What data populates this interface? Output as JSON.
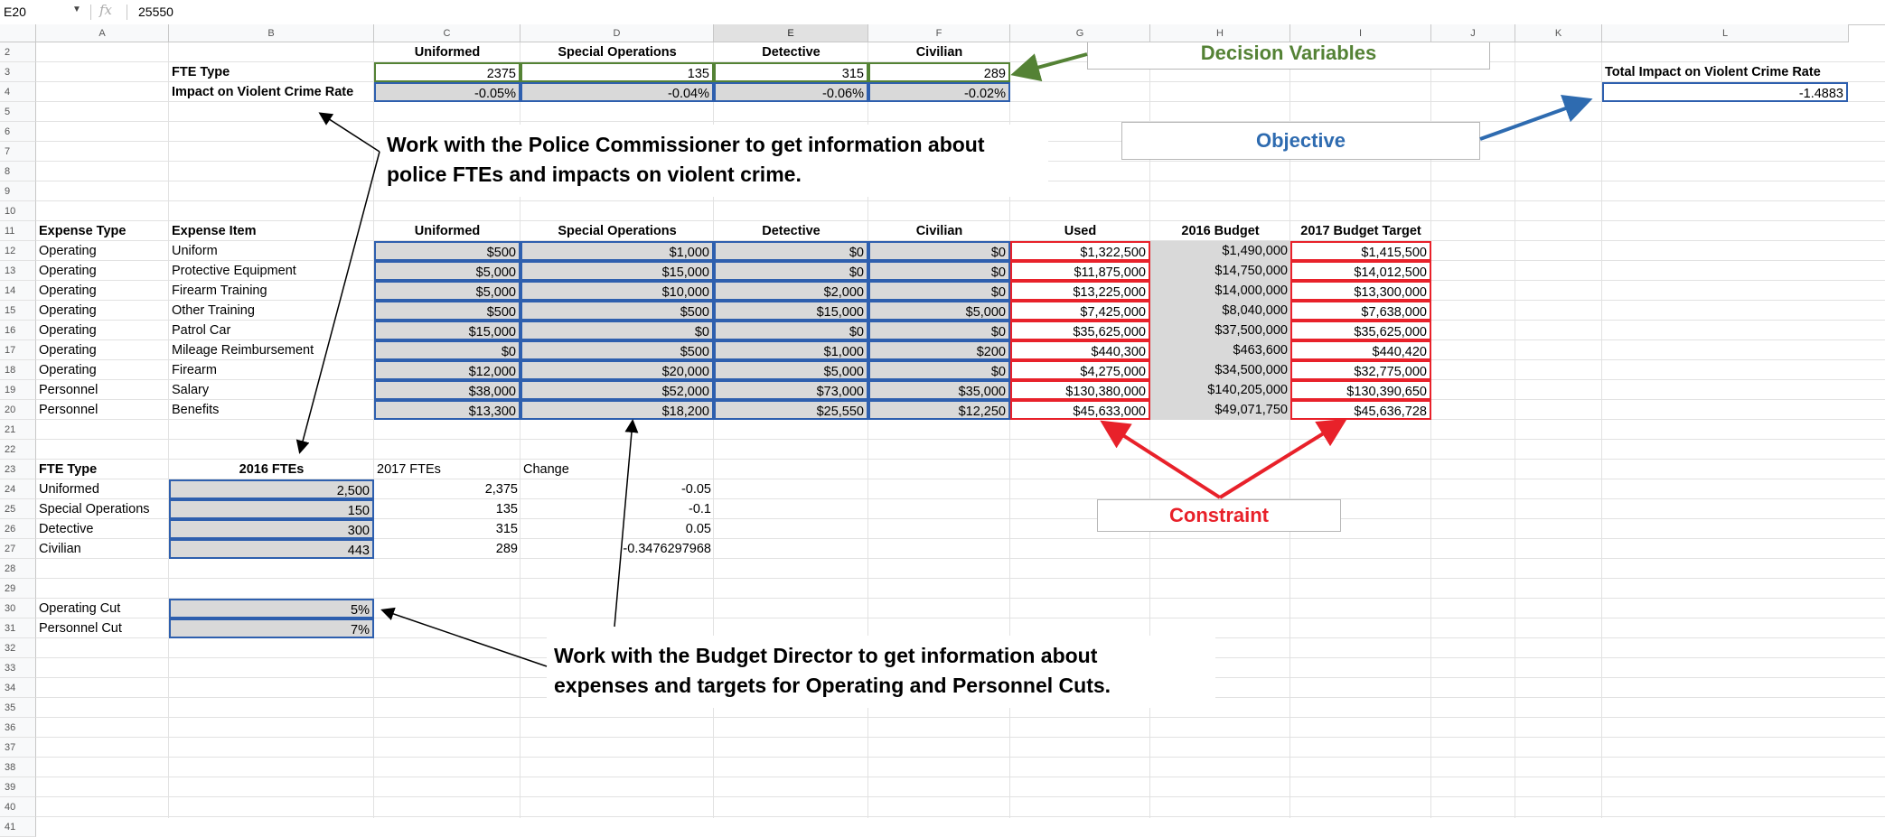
{
  "formula_bar": {
    "name_box": "E20",
    "fx": "fx",
    "value": "25550"
  },
  "columns": [
    "A",
    "B",
    "C",
    "D",
    "E",
    "F",
    "G",
    "H",
    "I",
    "J",
    "K",
    "L"
  ],
  "rows": [
    "2",
    "3",
    "4",
    "5",
    "6",
    "7",
    "8",
    "9",
    "10",
    "11",
    "12",
    "13",
    "14",
    "15",
    "16",
    "17",
    "18",
    "19",
    "20",
    "21",
    "22",
    "23",
    "24",
    "25",
    "26",
    "27",
    "28",
    "29",
    "30",
    "31",
    "32",
    "33",
    "34",
    "35",
    "36",
    "37",
    "38",
    "39",
    "40",
    "41"
  ],
  "fte_header": [
    "Uniformed",
    "Special Operations",
    "Detective",
    "Civilian"
  ],
  "fte_type_label": "FTE Type",
  "impact_label": "Impact on Violent Crime Rate",
  "fte_values": [
    "2375",
    "135",
    "315",
    "289"
  ],
  "impact_values": [
    "-0.05%",
    "-0.04%",
    "-0.06%",
    "-0.02%"
  ],
  "total_impact_label": "Total Impact on Violent Crime Rate",
  "total_impact_value": "-1.4883",
  "expense_headers": [
    "Expense Type",
    "Expense Item",
    "Uniformed",
    "Special Operations",
    "Detective",
    "Civilian",
    "Used",
    "2016 Budget",
    "2017 Budget Target"
  ],
  "expense_rows": [
    [
      "Operating",
      "Uniform",
      "$500",
      "$1,000",
      "$0",
      "$0",
      "$1,322,500",
      "$1,490,000",
      "$1,415,500"
    ],
    [
      "Operating",
      "Protective Equipment",
      "$5,000",
      "$15,000",
      "$0",
      "$0",
      "$11,875,000",
      "$14,750,000",
      "$14,012,500"
    ],
    [
      "Operating",
      "Firearm Training",
      "$5,000",
      "$10,000",
      "$2,000",
      "$0",
      "$13,225,000",
      "$14,000,000",
      "$13,300,000"
    ],
    [
      "Operating",
      "Other Training",
      "$500",
      "$500",
      "$15,000",
      "$5,000",
      "$7,425,000",
      "$8,040,000",
      "$7,638,000"
    ],
    [
      "Operating",
      "Patrol Car",
      "$15,000",
      "$0",
      "$0",
      "$0",
      "$35,625,000",
      "$37,500,000",
      "$35,625,000"
    ],
    [
      "Operating",
      "Mileage Reimbursement",
      "$0",
      "$500",
      "$1,000",
      "$200",
      "$440,300",
      "$463,600",
      "$440,420"
    ],
    [
      "Operating",
      "Firearm",
      "$12,000",
      "$20,000",
      "$5,000",
      "$0",
      "$4,275,000",
      "$34,500,000",
      "$32,775,000"
    ],
    [
      "Personnel",
      "Salary",
      "$38,000",
      "$52,000",
      "$73,000",
      "$35,000",
      "$130,380,000",
      "$140,205,000",
      "$130,390,650"
    ],
    [
      "Personnel",
      "Benefits",
      "$13,300",
      "$18,200",
      "$25,550",
      "$12,250",
      "$45,633,000",
      "$49,071,750",
      "$45,636,728"
    ]
  ],
  "fte_table_headers": [
    "FTE Type",
    "2016 FTEs",
    "2017 FTEs",
    "Change"
  ],
  "fte_table_rows": [
    [
      "Uniformed",
      "2,500",
      "2,375",
      "-0.05"
    ],
    [
      "Special Operations",
      "150",
      "135",
      "-0.1"
    ],
    [
      "Detective",
      "300",
      "315",
      "0.05"
    ],
    [
      "Civilian",
      "443",
      "289",
      "-0.3476297968"
    ]
  ],
  "cuts": [
    [
      "Operating Cut",
      "5%"
    ],
    [
      "Personnel Cut",
      "7%"
    ]
  ],
  "labels": {
    "decision": "Decision Variables",
    "objective": "Objective",
    "constraint": "Constraint"
  },
  "callouts": {
    "commissioner_1": "Work with the Police Commissioner to get information about",
    "commissioner_2": "police FTEs and impacts on violent crime.",
    "budget_1": "Work with the Budget Director to get information about",
    "budget_2": "expenses and targets for Operating and Personnel Cuts."
  },
  "colors": {
    "decision": "#548235",
    "objective": "#2e6bb0",
    "constraint": "#e8212a"
  }
}
